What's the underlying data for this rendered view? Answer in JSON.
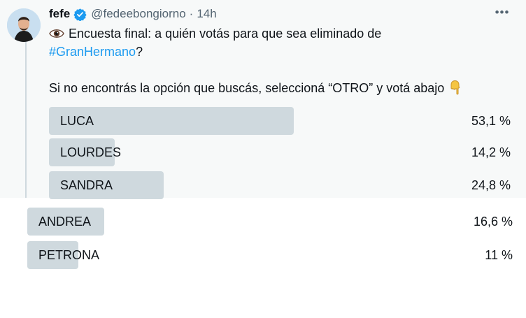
{
  "tweet": {
    "display_name": "fefe",
    "handle": "@fedeebongiorno",
    "separator": "·",
    "time": "14h",
    "text_line1": "Encuesta final: a quién votás para que sea eliminado de",
    "hashtag": "#GranHermano",
    "hashtag_suffix": "?",
    "text_line3": "Si no encontrás la opción que buscás, seleccioná “OTRO” y votá abajo",
    "more_label": "•••"
  },
  "poll": {
    "options": [
      {
        "label": "LUCA",
        "percent": "53,1 %",
        "value": 53.1
      },
      {
        "label": "LOURDES",
        "percent": "14,2 %",
        "value": 14.2
      },
      {
        "label": "SANDRA",
        "percent": "24,8 %",
        "value": 24.8
      },
      {
        "label": "ANDREA",
        "percent": "16,6 %",
        "value": 16.6
      },
      {
        "label": "PETRONA",
        "percent": "11 %",
        "value": 11
      }
    ]
  },
  "colors": {
    "bar": "#cfd9de",
    "link": "#1d9bf0",
    "verified": "#1d9bf0",
    "panel_bg": "#f7f9f9"
  },
  "icons": [
    "avatar",
    "verified-badge-icon",
    "more-icon",
    "eye-icon",
    "pointing-down-hand-icon"
  ]
}
